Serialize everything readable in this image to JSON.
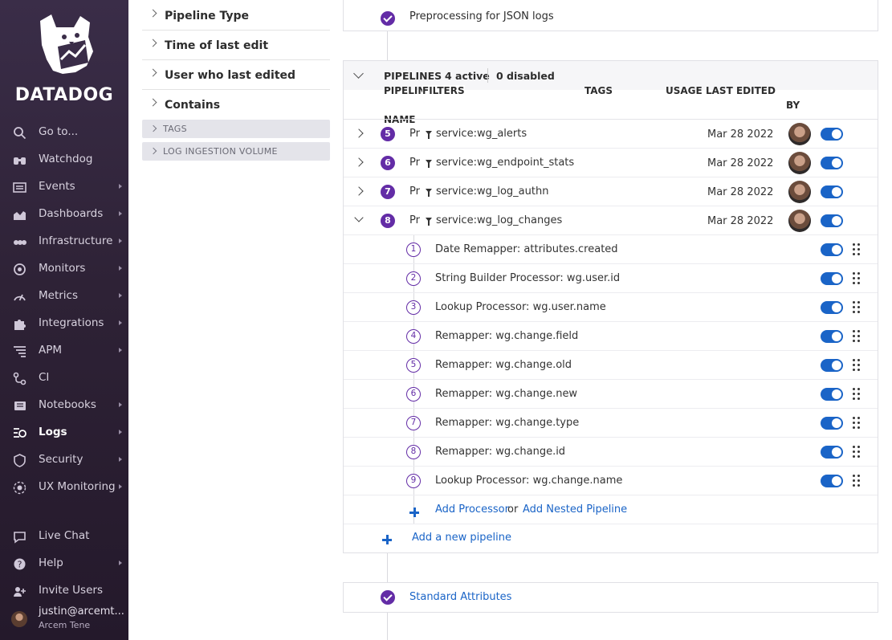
{
  "brand": {
    "logo_text": "DATADOG",
    "accent": "#632ca6",
    "link": "#1a64c7"
  },
  "sidebar": {
    "items": [
      {
        "label": "Go to...",
        "icon": "search-icon"
      },
      {
        "label": "Watchdog",
        "icon": "binoculars-icon"
      },
      {
        "label": "Events",
        "icon": "events-icon"
      },
      {
        "label": "Dashboards",
        "icon": "dashboard-chart-icon"
      },
      {
        "label": "Infrastructure",
        "icon": "infrastructure-icon"
      },
      {
        "label": "Monitors",
        "icon": "monitor-icon"
      },
      {
        "label": "Metrics",
        "icon": "metrics-gauge-icon"
      },
      {
        "label": "Integrations",
        "icon": "puzzle-icon"
      },
      {
        "label": "APM",
        "icon": "apm-icon"
      },
      {
        "label": "CI",
        "icon": "ci-icon"
      },
      {
        "label": "Notebooks",
        "icon": "notebook-icon"
      },
      {
        "label": "Logs",
        "icon": "logs-icon"
      },
      {
        "label": "Security",
        "icon": "shield-icon"
      },
      {
        "label": "UX Monitoring",
        "icon": "ux-monitoring-icon"
      }
    ],
    "bottom": [
      {
        "label": "Live Chat",
        "icon": "chat-icon"
      },
      {
        "label": "Help",
        "icon": "help-icon"
      },
      {
        "label": "Invite Users",
        "icon": "invite-users-icon"
      }
    ],
    "user": {
      "email": "justin@arcemt...",
      "org": "Arcem Tene"
    }
  },
  "facets": {
    "items": [
      "Pipeline Type",
      "Time of last edit",
      "User who last edited",
      "Contains"
    ],
    "groups": [
      "TAGS",
      "LOG INGESTION VOLUME"
    ]
  },
  "preprocessing": {
    "label": "Preprocessing for JSON logs"
  },
  "pipelines": {
    "title": "PIPELINES",
    "active": "4 active",
    "disabled": "0 disabled",
    "columns": {
      "pipeline": "PIPELINE",
      "name": "NAME",
      "filters": "FILTERS",
      "tags": "TAGS",
      "usage": "USAGE",
      "last_edited": "LAST EDITED",
      "by": "BY"
    },
    "rows": [
      {
        "num": "5",
        "name": "Pr",
        "filter": "service:wg_alerts",
        "edited": "Mar 28 2022",
        "enabled": true,
        "expanded": false
      },
      {
        "num": "6",
        "name": "Pr",
        "filter": "service:wg_endpoint_stats",
        "edited": "Mar 28 2022",
        "enabled": true,
        "expanded": false
      },
      {
        "num": "7",
        "name": "Pr",
        "filter": "service:wg_log_authn",
        "edited": "Mar 28 2022",
        "enabled": true,
        "expanded": false
      },
      {
        "num": "8",
        "name": "Pr",
        "filter": "service:wg_log_changes",
        "edited": "Mar 28 2022",
        "enabled": true,
        "expanded": true
      }
    ],
    "processors": [
      {
        "num": "1",
        "label": "Date Remapper: attributes.created",
        "enabled": true
      },
      {
        "num": "2",
        "label": "String Builder Processor: wg.user.id",
        "enabled": true
      },
      {
        "num": "3",
        "label": "Lookup Processor: wg.user.name",
        "enabled": true
      },
      {
        "num": "4",
        "label": "Remapper: wg.change.field",
        "enabled": true
      },
      {
        "num": "5",
        "label": "Remapper: wg.change.old",
        "enabled": true
      },
      {
        "num": "6",
        "label": "Remapper: wg.change.new",
        "enabled": true
      },
      {
        "num": "7",
        "label": "Remapper: wg.change.type",
        "enabled": true
      },
      {
        "num": "8",
        "label": "Remapper: wg.change.id",
        "enabled": true
      },
      {
        "num": "9",
        "label": "Lookup Processor: wg.change.name",
        "enabled": true
      }
    ],
    "add_processor": "Add Processor",
    "or": "or",
    "add_nested": "Add Nested Pipeline",
    "add_pipeline": "Add a new pipeline"
  },
  "standard_attributes": {
    "label": "Standard Attributes"
  }
}
